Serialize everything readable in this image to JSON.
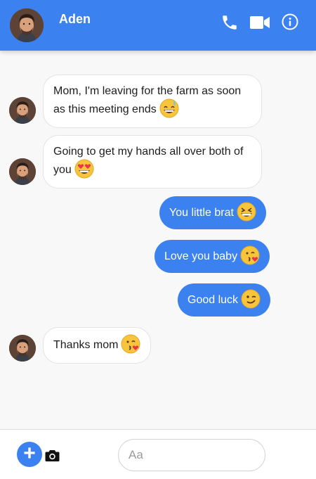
{
  "header": {
    "contact_name": "Aden",
    "icons": [
      "phone-icon",
      "video-camera-icon",
      "info-icon"
    ],
    "bg_color": "#3b82f0"
  },
  "messages": [
    {
      "direction": "incoming",
      "text": "Mom, I'm leaving for the farm as soon as this meeting ends",
      "emoji": "grinning-sweat-emoji"
    },
    {
      "direction": "incoming",
      "text": "Going to get my hands all over both of you",
      "emoji": "heart-eyes-emoji"
    },
    {
      "direction": "outgoing",
      "text": "You little brat",
      "emoji": "grinning-squinting-emoji"
    },
    {
      "direction": "outgoing",
      "text": "Love you baby",
      "emoji": "kissing-heart-emoji"
    },
    {
      "direction": "outgoing",
      "text": "Good luck",
      "emoji": "winking-emoji"
    },
    {
      "direction": "incoming",
      "text": "Thanks mom",
      "emoji": "kissing-heart-emoji"
    }
  ],
  "composer": {
    "placeholder": "Aa",
    "value": "",
    "plus_label": "+",
    "icons": [
      "plus-icon",
      "camera-icon"
    ]
  }
}
